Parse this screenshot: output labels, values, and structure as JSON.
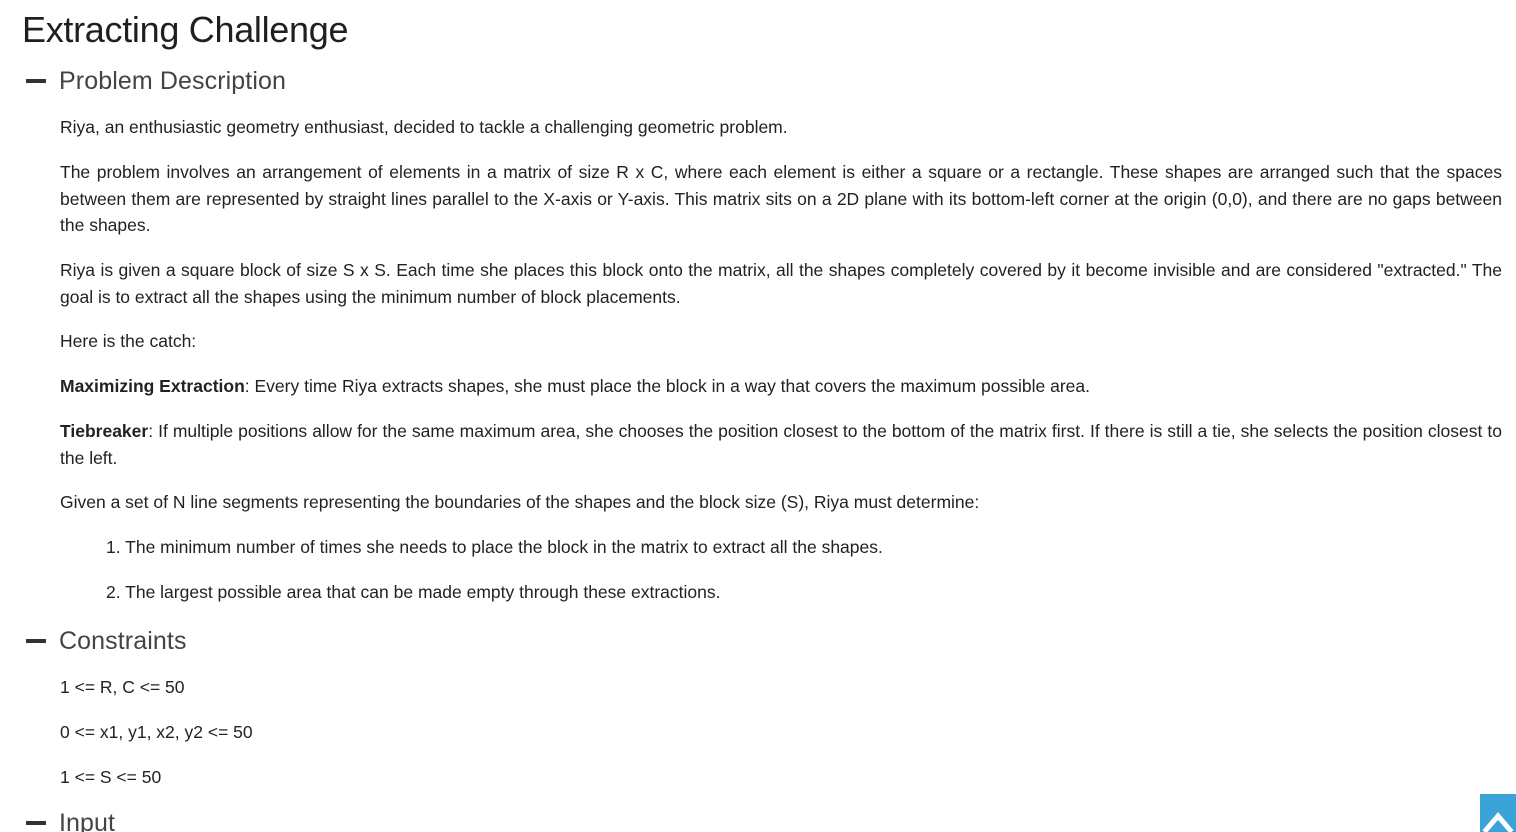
{
  "page": {
    "title": "Extracting Challenge"
  },
  "sections": {
    "problem_description": {
      "title": "Problem Description",
      "p1": "Riya, an enthusiastic geometry enthusiast, decided to tackle a challenging geometric problem.",
      "p2": "The problem involves an arrangement of elements in a matrix of size R x C, where each element is either a square or a rectangle. These shapes are arranged such that the spaces between them are represented by straight lines parallel to the X-axis or Y-axis. This matrix sits on a 2D plane with its bottom-left corner at the origin (0,0), and there are no gaps between the shapes.",
      "p3": "Riya is given a square block of size S x S. Each time she places this block onto the matrix, all the shapes completely covered by it become invisible and are considered \"extracted.\" The goal is to extract all the shapes using the minimum number of block placements.",
      "p4": "Here is the catch:",
      "rule1_label": "Maximizing Extraction",
      "rule1_text": ": Every time Riya extracts shapes, she must place the block in a way that covers the maximum possible area.",
      "rule2_label": "Tiebreaker",
      "rule2_text": ": If multiple positions allow for the same maximum area, she chooses the position closest to the bottom of the matrix first. If there is still a tie, she selects the position closest to the left.",
      "p5": "Given a set of N line segments representing the boundaries of the shapes and the block size (S), Riya must determine:",
      "list": [
        "1. The minimum number of times she needs to place the block in the matrix to extract all the shapes.",
        "2. The largest possible area that can be made empty through these extractions."
      ]
    },
    "constraints": {
      "title": "Constraints",
      "items": [
        "1 <= R, C <= 50",
        "0 <= x1, y1, x2, y2 <= 50",
        "1 <= S <= 50"
      ]
    },
    "input": {
      "title": "Input"
    }
  },
  "icons": {
    "collapse": "minus-icon",
    "scroll_top": "chevron-up-icon"
  },
  "colors": {
    "scroll_top_bg": "#3aa4d8",
    "text": "#222222",
    "section_title": "#444444"
  }
}
